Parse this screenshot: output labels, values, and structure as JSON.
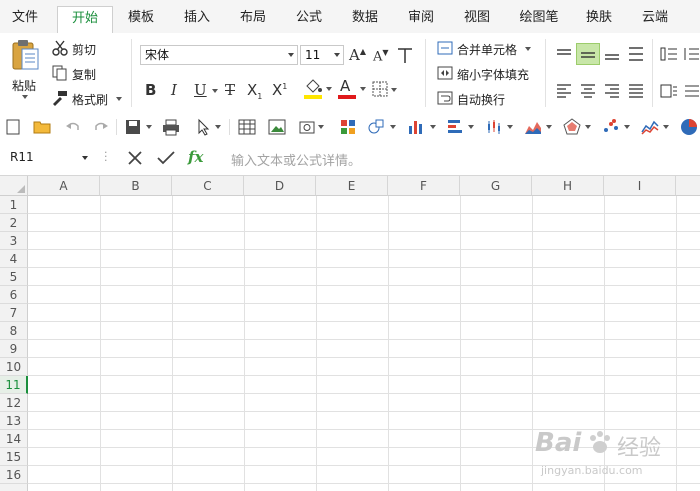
{
  "menu": {
    "tabs": [
      {
        "label": "文件"
      },
      {
        "label": "开始"
      },
      {
        "label": "模板"
      },
      {
        "label": "插入"
      },
      {
        "label": "布局"
      },
      {
        "label": "公式"
      },
      {
        "label": "数据"
      },
      {
        "label": "审阅"
      },
      {
        "label": "视图"
      },
      {
        "label": "绘图笔"
      },
      {
        "label": "换肤"
      },
      {
        "label": "云端"
      }
    ],
    "active_tab": "开始",
    "accent_color": "#1a8f3c"
  },
  "ribbon": {
    "paste_label": "粘贴",
    "cut_label": "剪切",
    "copy_label": "复制",
    "format_painter_label": "格式刷",
    "font_name": "宋体",
    "font_size": "11",
    "merge_label": "合并单元格",
    "shrink_label": "缩小字体填充",
    "wrap_label": "自动换行",
    "font_color": "#e0191b",
    "highlight_color": "#ffe600"
  },
  "formula_bar": {
    "name_box": "R11",
    "fx_label": "fx",
    "placeholder": "输入文本或公式详情。"
  },
  "sheet": {
    "columns": [
      "A",
      "B",
      "C",
      "D",
      "E",
      "F",
      "G",
      "H",
      "I"
    ],
    "rows": [
      "1",
      "2",
      "3",
      "4",
      "5",
      "6",
      "7",
      "8",
      "9",
      "10",
      "11",
      "12",
      "13",
      "14",
      "15",
      "16"
    ],
    "active_row": "11"
  },
  "watermark": {
    "brand": "Bai",
    "brand_suffix": "经验",
    "url": "jingyan.baidu.com"
  }
}
